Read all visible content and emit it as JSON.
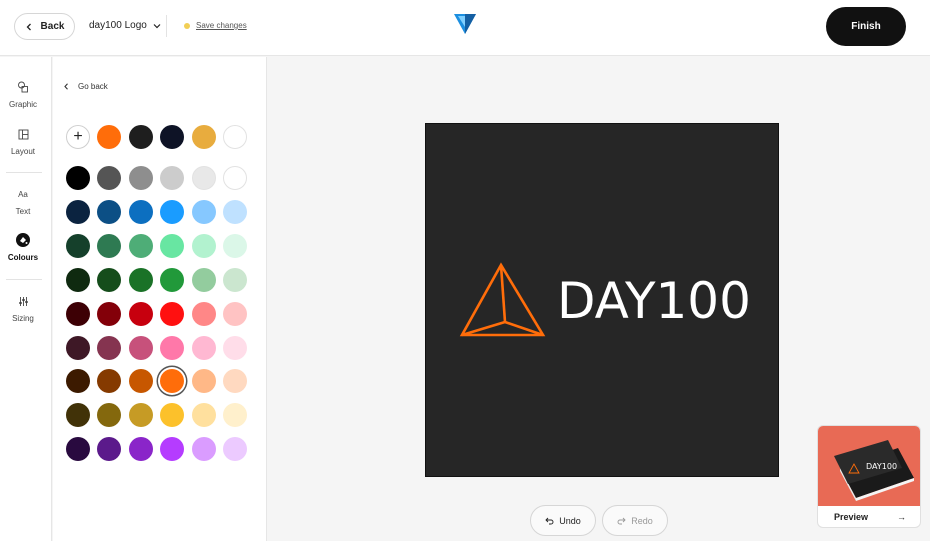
{
  "header": {
    "back_label": "Back",
    "document_name": "day100 Logo",
    "save_label": "Save changes",
    "finish_label": "Finish"
  },
  "rail": {
    "items": [
      {
        "label": "Graphic",
        "icon": "graphic-icon"
      },
      {
        "label": "Layout",
        "icon": "layout-icon"
      },
      {
        "label": "Text",
        "icon_text": "Aa"
      },
      {
        "label": "Colours",
        "icon": "colour-drop-icon",
        "active": true
      },
      {
        "label": "Sizing",
        "icon": "sliders-icon"
      }
    ]
  },
  "panel": {
    "go_back_label": "Go back",
    "recent_colours": [
      "#ff6d0a",
      "#1e1e1e",
      "#0e1326",
      "#e8ac3e",
      "#ffffff"
    ],
    "palette": [
      [
        "#000000",
        "#555555",
        "#8e8e8e",
        "#cccccc",
        "#e8e8e8",
        "#ffffff"
      ],
      [
        "#0b2340",
        "#0c4f85",
        "#0c6fc0",
        "#1a9cff",
        "#86c8ff",
        "#bfe1ff"
      ],
      [
        "#15402b",
        "#2e7a52",
        "#4ead77",
        "#68e6a2",
        "#b2f2cf",
        "#dbf7e8"
      ],
      [
        "#0f2a10",
        "#154d1b",
        "#1a7227",
        "#21993a",
        "#93cc9e",
        "#cbe6cf"
      ],
      [
        "#3d0005",
        "#830009",
        "#c7000e",
        "#ff1010",
        "#ff8787",
        "#ffc3c3"
      ],
      [
        "#3e1826",
        "#853450",
        "#c7517b",
        "#ff78a9",
        "#ffb8d2",
        "#ffdde9"
      ],
      [
        "#3c1a00",
        "#853a00",
        "#c75700",
        "#ff6d0a",
        "#ffb887",
        "#ffd9c0"
      ],
      [
        "#413208",
        "#84680d",
        "#c69b25",
        "#fcc12b",
        "#ffe09e",
        "#fff0cc"
      ],
      [
        "#290a3f",
        "#5b1a8b",
        "#8a25c9",
        "#b53cff",
        "#da9cff",
        "#eccaff"
      ]
    ],
    "selected": {
      "row": 6,
      "col": 3
    }
  },
  "canvas": {
    "logo_text": "DAY100",
    "background": "#262626",
    "mark_color": "#ff6d0a"
  },
  "history": {
    "undo_label": "Undo",
    "redo_label": "Redo"
  },
  "preview": {
    "label": "Preview",
    "arrow": "→",
    "card_text": "DAY100"
  }
}
